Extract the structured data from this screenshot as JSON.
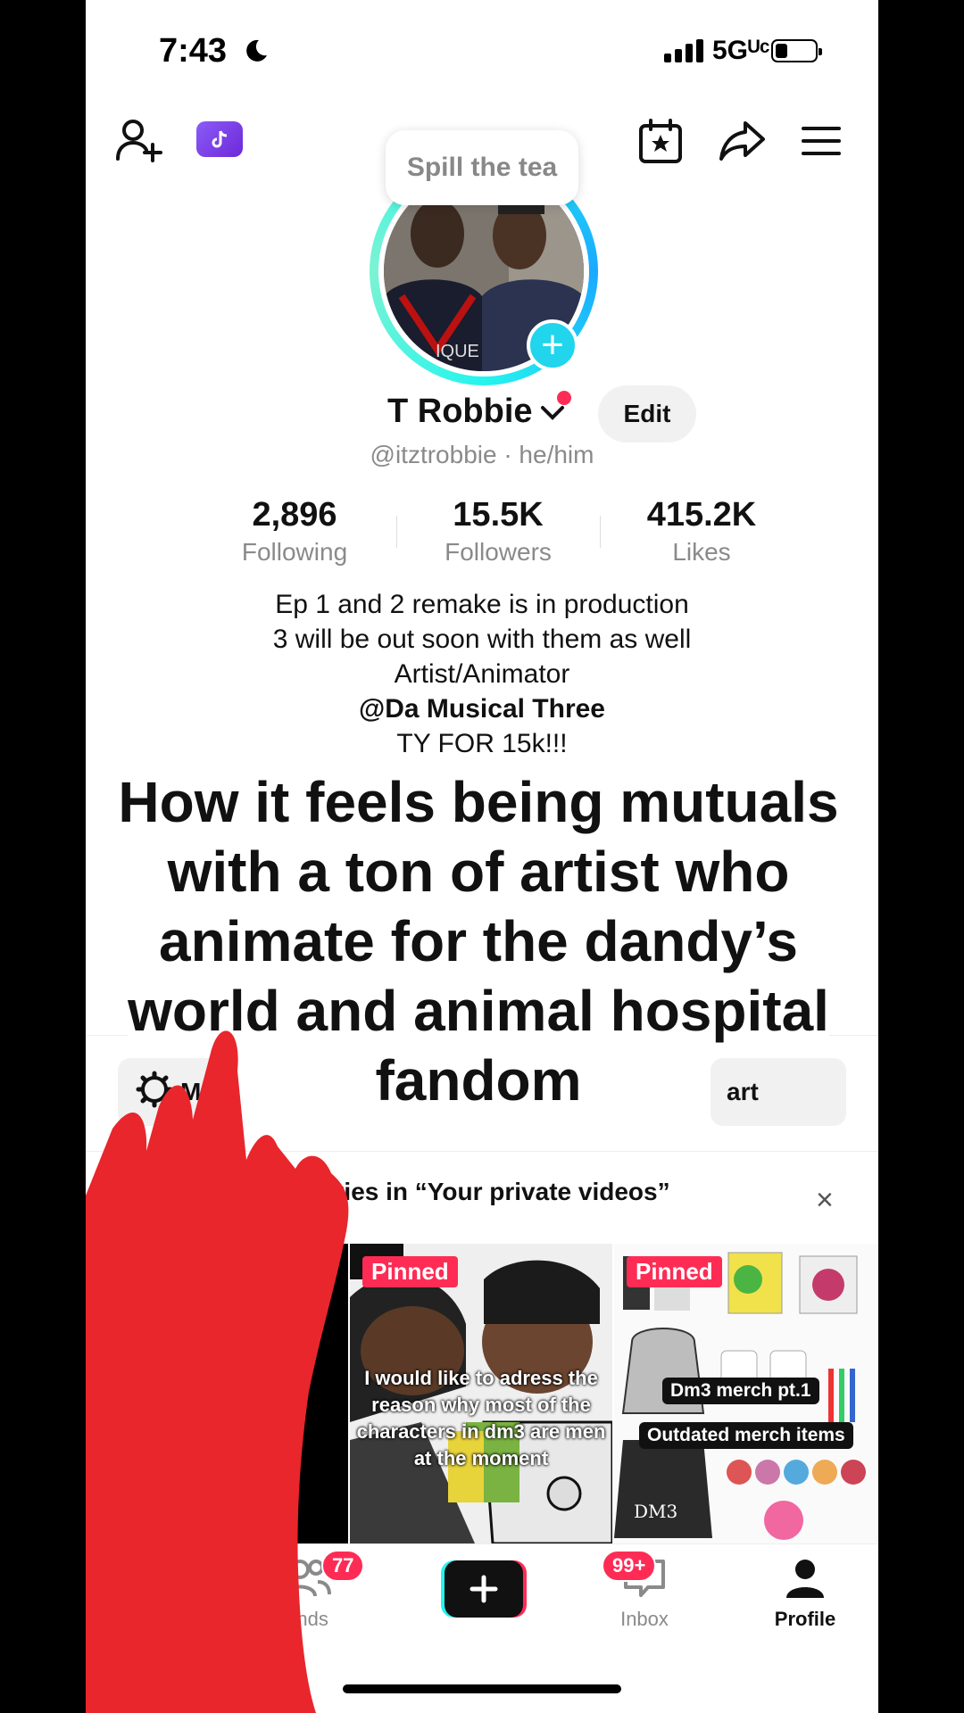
{
  "status_bar": {
    "time": "7:43",
    "network": "5Gᵁᶜ"
  },
  "header": {
    "tooltip": "Spill the tea"
  },
  "profile": {
    "display_name": "T Robbie",
    "edit_label": "Edit",
    "handle": "@itztrobbie · he/him"
  },
  "stats": [
    {
      "value": "2,896",
      "label": "Following"
    },
    {
      "value": "15.5K",
      "label": "Followers"
    },
    {
      "value": "415.2K",
      "label": "Likes"
    }
  ],
  "bio": {
    "line1": "Ep 1 and 2 remake is in production",
    "line2": "3 will be out soon with them as well",
    "line3": "Artist/Animator",
    "mention": "@Da Musical Three",
    "line5": "TY FOR 15k!!!"
  },
  "overlay_caption": "How it feels being mutuals with a ton of artist who animate for the dandy’s world and animal hospital fandom",
  "pills": {
    "left_partial": "Man",
    "right_partial": "art"
  },
  "stories_banner": {
    "text": "Stories in “Your private videos”",
    "close": "×"
  },
  "videos": [
    {
      "pinned": "Pinned",
      "caption": "I would like to adress the reason  why most of the characters in dm3 are men at the moment"
    },
    {
      "pinned": "Pinned",
      "tag1": "Dm3 merch pt.1",
      "tag2": "Outdated merch items",
      "bag_text": "DM3"
    }
  ],
  "tabbar": {
    "friends_label": "ends",
    "friends_badge": "77",
    "inbox_label": "Inbox",
    "inbox_badge": "99+",
    "profile_label": "Profile"
  },
  "colors": {
    "accent": "#fe2c55",
    "cyan": "#25f4ee",
    "redaction": "#e8262c"
  },
  "icons": [
    "add-friend-icon",
    "tiktok-studio-icon",
    "calendar-star-icon",
    "share-icon",
    "menu-icon",
    "chevron-down-icon",
    "settings-icon",
    "close-icon",
    "friends-icon",
    "plus-icon",
    "inbox-icon",
    "profile-icon",
    "moon-icon",
    "signal-icon",
    "battery-icon"
  ]
}
